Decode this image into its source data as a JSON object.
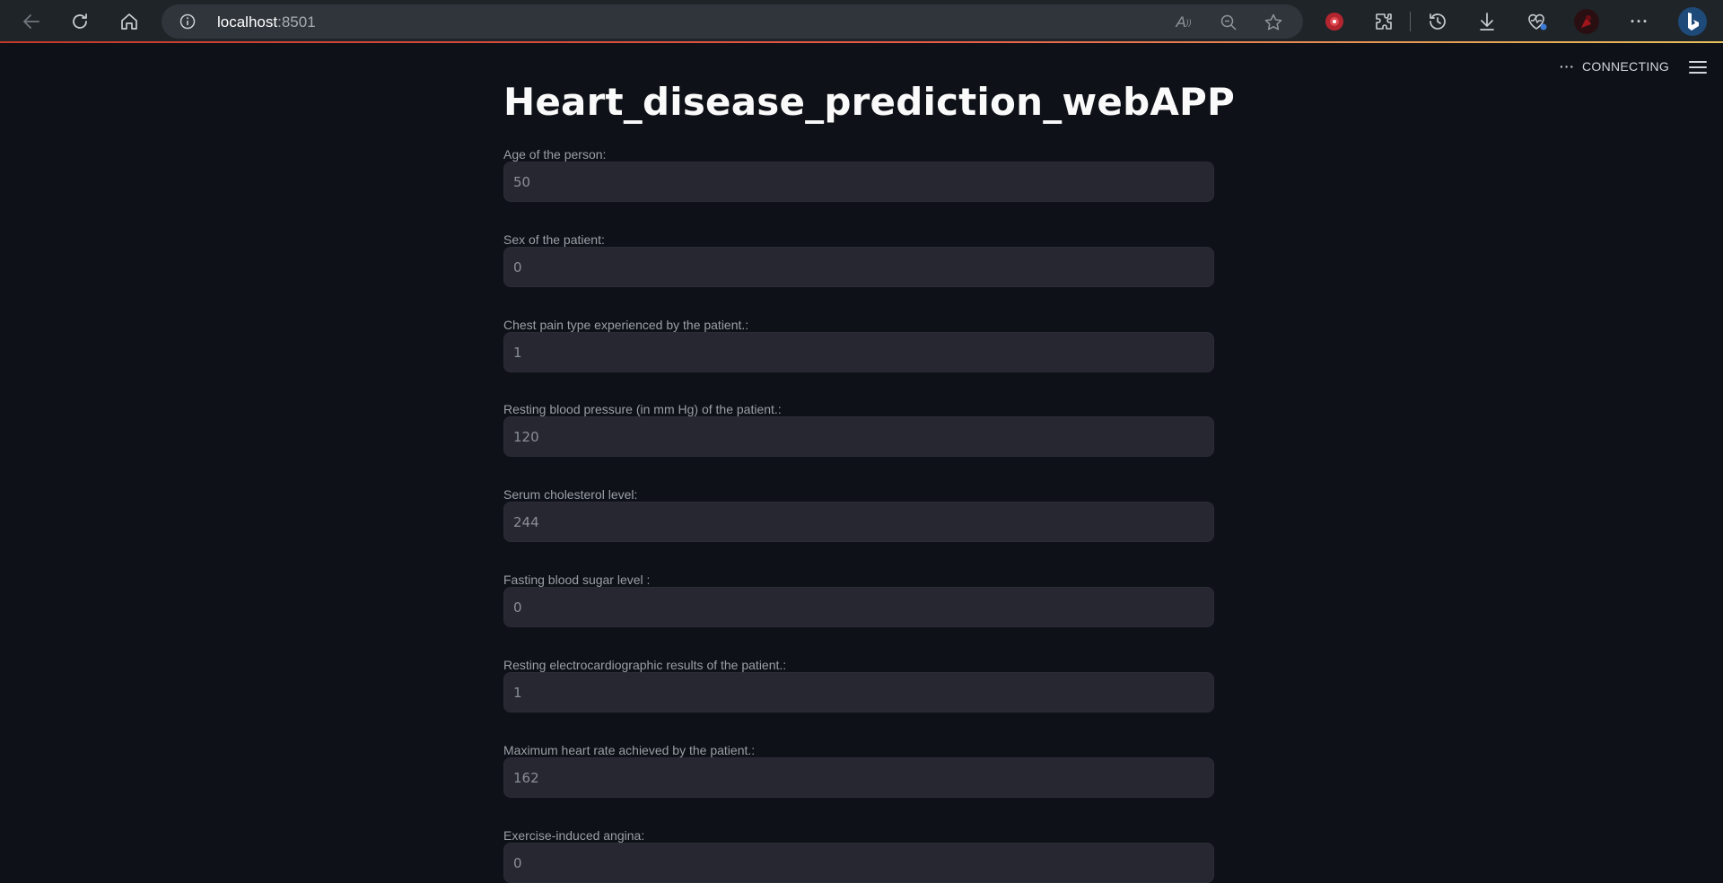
{
  "browser": {
    "url_host": "localhost",
    "url_port": ":8501",
    "icons": [
      "back-icon",
      "refresh-icon",
      "home-icon",
      "info-icon",
      "read-aloud-icon",
      "zoom-icon",
      "favorite-star-icon",
      "extension-red-icon",
      "extensions-puzzle-icon",
      "history-icon",
      "download-icon",
      "browser-essentials-icon",
      "profile-avatar-icon",
      "more-menu-icon",
      "bing-copilot-icon"
    ],
    "read_aloud_glyph": "A",
    "more_glyph": "···"
  },
  "app": {
    "status_dots": "···",
    "status_text": "CONNECTING",
    "title": "Heart_disease_prediction_webAPP"
  },
  "form": {
    "fields": [
      {
        "label": "Age of the person:",
        "value": "50"
      },
      {
        "label": "Sex of the patient:",
        "value": "0"
      },
      {
        "label": "Chest pain type experienced by the patient.:",
        "value": "1"
      },
      {
        "label": "Resting blood pressure (in mm Hg) of the patient.:",
        "value": "120"
      },
      {
        "label": "Serum cholesterol level:",
        "value": "244"
      },
      {
        "label": "Fasting blood sugar level :",
        "value": "0"
      },
      {
        "label": "Resting electrocardiographic results of the patient.:",
        "value": "1"
      },
      {
        "label": "Maximum heart rate achieved by the patient.:",
        "value": "162"
      },
      {
        "label": "Exercise-induced angina:",
        "value": "0"
      }
    ]
  },
  "colors": {
    "background": "#0e1117",
    "input_bg": "#262730",
    "browser_bar": "#1f2428",
    "loading_line_start": "#c0392b",
    "loading_line_end": "#e7c25a"
  }
}
